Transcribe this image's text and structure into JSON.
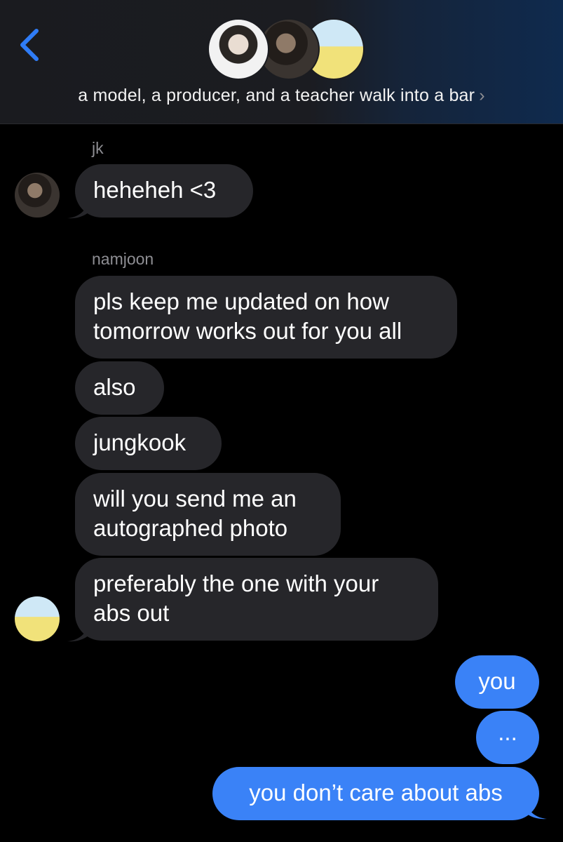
{
  "header": {
    "back_icon": "chevron-left-icon",
    "group_name": "a model, a producer, and a teacher walk into a bar",
    "chevron": "›",
    "avatars": [
      "group-member-1",
      "group-member-2",
      "group-member-3"
    ]
  },
  "colors": {
    "incoming_bubble": "#26262a",
    "outgoing_bubble": "#3a82f7",
    "accent": "#2f7cf6",
    "sender_name": "#8e8e93"
  },
  "messages": [
    {
      "sender": "jk",
      "text": "heheheh <3"
    },
    {
      "sender": "namjoon",
      "text_lines": [
        "pls keep me updated on how",
        "tomorrow works out for you all"
      ]
    },
    {
      "text": "also"
    },
    {
      "text": "jungkook"
    },
    {
      "text_lines": [
        "will you send me an",
        "autographed photo"
      ]
    },
    {
      "text_lines": [
        "preferably the one with your",
        "abs out"
      ]
    },
    {
      "outgoing": true,
      "text": "you"
    },
    {
      "outgoing": true,
      "text": "..."
    },
    {
      "outgoing": true,
      "text": "you don’t care about abs"
    }
  ]
}
